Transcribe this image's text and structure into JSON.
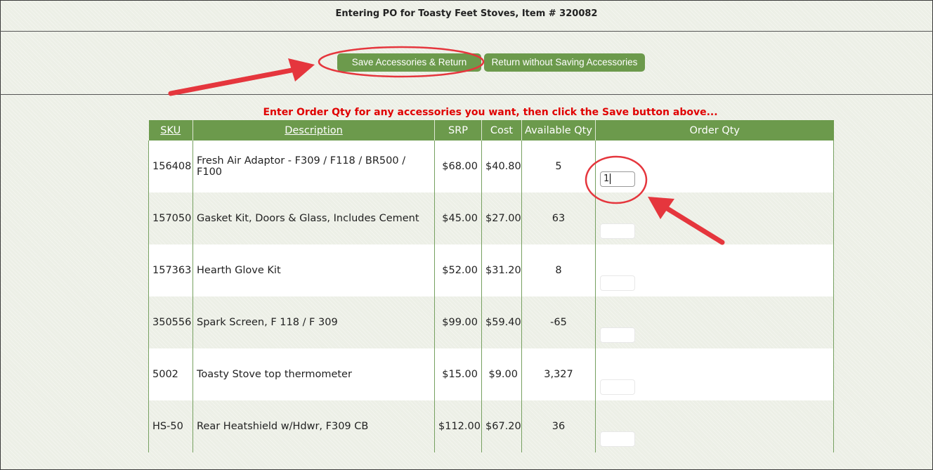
{
  "header": {
    "title": "Entering PO for Toasty Feet Stoves, Item # 320082"
  },
  "toolbar": {
    "save_label": "Save Accessories & Return",
    "return_label": "Return without Saving Accessories"
  },
  "instruction": "Enter Order Qty for any accessories you want, then click the Save button above...",
  "table": {
    "columns": [
      "SKU",
      "Description",
      "SRP",
      "Cost",
      "Available Qty",
      "Order Qty"
    ],
    "rows": [
      {
        "sku": "156408",
        "description": "Fresh Air Adaptor - F309 / F118 / BR500 / F100",
        "srp": "$68.00",
        "cost": "$40.80",
        "available": "5",
        "order_qty": "1"
      },
      {
        "sku": "157050",
        "description": "Gasket Kit, Doors & Glass, Includes Cement",
        "srp": "$45.00",
        "cost": "$27.00",
        "available": "63",
        "order_qty": ""
      },
      {
        "sku": "157363",
        "description": "Hearth Glove Kit",
        "srp": "$52.00",
        "cost": "$31.20",
        "available": "8",
        "order_qty": ""
      },
      {
        "sku": "350556",
        "description": "Spark Screen, F 118 / F 309",
        "srp": "$99.00",
        "cost": "$59.40",
        "available": "-65",
        "order_qty": ""
      },
      {
        "sku": "5002",
        "description": "Toasty Stove top thermometer",
        "srp": "$15.00",
        "cost": "$9.00",
        "available": "3,327",
        "order_qty": ""
      },
      {
        "sku": "HS-50",
        "description": "Rear Heatshield w/Hdwr, F309 CB",
        "srp": "$112.00",
        "cost": "$67.20",
        "available": "36",
        "order_qty": ""
      }
    ]
  },
  "colors": {
    "accent_green": "#6c9a4c",
    "instruction_red": "#e00000",
    "annotation_red": "#e5363d"
  },
  "icons": {
    "annotation": "red-arrow-icon"
  }
}
